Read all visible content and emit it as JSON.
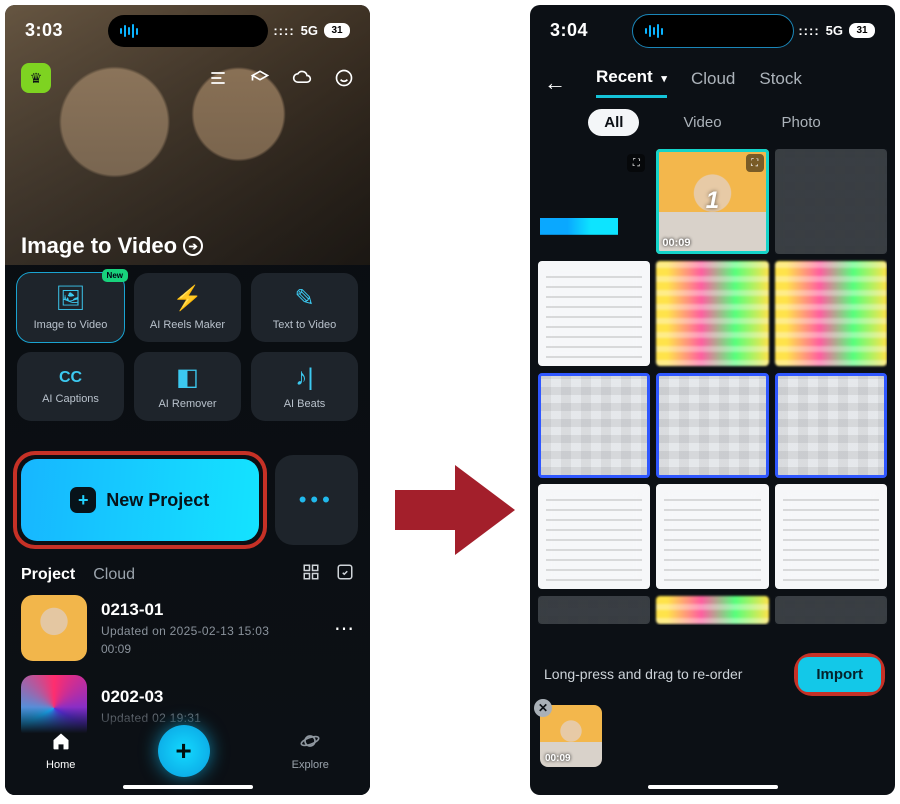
{
  "left": {
    "status": {
      "time": "3:03",
      "network": "5G",
      "battery": "31"
    },
    "section_title": "Image to Video",
    "tools": [
      {
        "label": "Image to Video",
        "badge": "New"
      },
      {
        "label": "AI Reels Maker"
      },
      {
        "label": "Text  to Video"
      },
      {
        "label": "AI Captions"
      },
      {
        "label": "AI Remover"
      },
      {
        "label": "AI Beats"
      }
    ],
    "new_project_label": "New Project",
    "project_tabs": {
      "active": "Project",
      "other": "Cloud"
    },
    "projects": [
      {
        "title": "0213-01",
        "updated": "Updated on 2025-02-13 15:03",
        "duration": "00:09"
      },
      {
        "title": "0202-03",
        "updated": "Updated                02 19:31",
        "duration": ""
      }
    ],
    "nav": {
      "home": "Home",
      "explore": "Explore"
    }
  },
  "right": {
    "status": {
      "time": "3:04",
      "network": "5G",
      "battery": "31"
    },
    "source_tabs": {
      "recent": "Recent",
      "cloud": "Cloud",
      "stock": "Stock"
    },
    "filters": {
      "all": "All",
      "video": "Video",
      "photo": "Photo"
    },
    "selected_media": {
      "index": "1",
      "duration": "00:09"
    },
    "footer_hint": "Long-press and drag to re-order",
    "import_label": "Import",
    "tray_item_duration": "00:09"
  }
}
